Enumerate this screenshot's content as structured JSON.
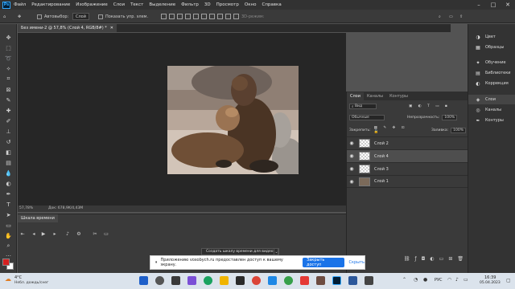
{
  "menubar": {
    "logo": "Ps",
    "items": [
      "Файл",
      "Редактирование",
      "Изображение",
      "Слои",
      "Текст",
      "Выделение",
      "Фильтр",
      "3D",
      "Просмотр",
      "Окно",
      "Справка"
    ]
  },
  "options": {
    "autoselect_label": "Автовыбор:",
    "autoselect_value": "Слой",
    "show_controls_label": "Показать упр. элем.",
    "mode3d_label": "3D-режим:"
  },
  "document": {
    "tab_title": "Без имени-2 @ 57,8% (Слой 4, RGB/8#) *",
    "zoom": "57,78%",
    "doc_info": "Док: 678,9K/4,43M"
  },
  "timeline": {
    "tab": "Шкала времени",
    "create_label": "Создать шкалу времени для видео"
  },
  "layers": {
    "tabs": [
      "Слои",
      "Каналы",
      "Контуры"
    ],
    "kind_label": "Вид",
    "blend_mode": "Обычные",
    "opacity_label": "Непрозрачность:",
    "opacity_value": "100%",
    "lock_label": "Закрепить:",
    "fill_label": "Заливка:",
    "fill_value": "100%",
    "items": [
      {
        "name": "Слой 2"
      },
      {
        "name": "Слой 4"
      },
      {
        "name": "Слой 3"
      },
      {
        "name": "Слой 1"
      }
    ]
  },
  "dock": {
    "items": [
      "Цвет",
      "Образцы",
      "Обучение",
      "Библиотеки",
      "Коррекция",
      "Слои",
      "Каналы",
      "Контуры"
    ]
  },
  "popup": {
    "message": "Приложению voxobych.ru предоставлен доступ к вашему экрану.",
    "button": "Закрыть доступ",
    "hide": "Скрыть"
  },
  "taskbar": {
    "weather_temp": "4°C",
    "weather_desc": "Небл. дождь/снег",
    "lang": "РУС",
    "time": "16:39",
    "date": "05.04.2023"
  },
  "colors": {
    "foreground": "#d42020",
    "background": "#ffffff",
    "accent": "#31a8ff"
  }
}
